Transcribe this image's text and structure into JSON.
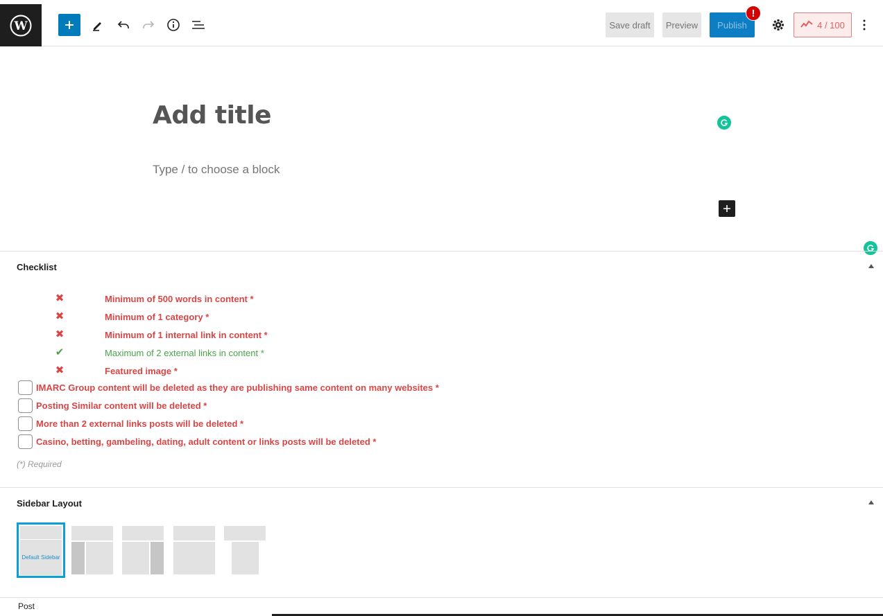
{
  "toolbar": {
    "save_draft_label": "Save draft",
    "preview_label": "Preview",
    "publish_label": "Publish",
    "alert_badge": "!",
    "score_label": "4 / 100"
  },
  "editor": {
    "title_placeholder": "Add title",
    "block_placeholder": "Type / to choose a block"
  },
  "checklist": {
    "title": "Checklist",
    "items": [
      {
        "label": "Minimum of 500 words in content *",
        "status": "fail"
      },
      {
        "label": "Minimum of 1 category *",
        "status": "fail"
      },
      {
        "label": "Minimum of 1 internal link in content *",
        "status": "fail"
      },
      {
        "label": "Maximum of 2 external links in content *",
        "status": "pass"
      },
      {
        "label": "Featured image *",
        "status": "fail"
      }
    ],
    "checkboxes": [
      {
        "label": "IMARC Group content will be deleted as they are publishing same content on many websites *",
        "checked": false
      },
      {
        "label": "Posting Similar content will be deleted *",
        "checked": false
      },
      {
        "label": "More than 2 external links posts will be deleted *",
        "checked": false
      },
      {
        "label": "Casino, betting, gambeling, dating, adult content or links posts will be deleted *",
        "checked": false
      }
    ],
    "required_note": "(*) Required"
  },
  "sidebar_layout": {
    "title": "Sidebar Layout",
    "selected_label": "Default Sidebar"
  },
  "footer": {
    "breadcrumb": "Post"
  },
  "colors": {
    "accent": "#007cba",
    "fail": "#d94545",
    "pass": "#4aa34a",
    "selected_border": "#0b9fd8"
  }
}
